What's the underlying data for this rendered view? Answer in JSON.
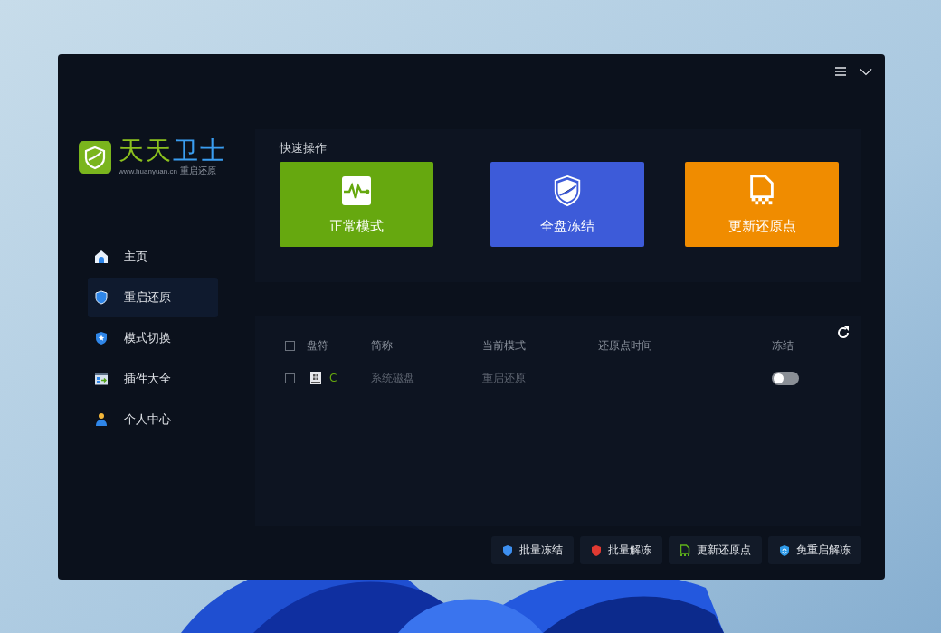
{
  "logo": {
    "title_a": "天天",
    "title_b": "卫士",
    "url": "www.huanyuan.cn",
    "tag": "重启还原"
  },
  "sidebar": {
    "items": [
      {
        "label": "主页",
        "kind": "home",
        "selected": false
      },
      {
        "label": "重启还原",
        "kind": "shield",
        "selected": true
      },
      {
        "label": "模式切换",
        "kind": "star",
        "selected": false
      },
      {
        "label": "插件大全",
        "kind": "plugin",
        "selected": false
      },
      {
        "label": "个人中心",
        "kind": "person",
        "selected": false
      }
    ]
  },
  "quick_actions": {
    "title": "快速操作",
    "cards": [
      {
        "label": "正常模式",
        "kind": "pulse",
        "color": "#66a80f"
      },
      {
        "label": "全盘冻结",
        "kind": "shield",
        "color": "#3d5bd9"
      },
      {
        "label": "更新还原点",
        "kind": "file",
        "color": "#f08c00"
      }
    ]
  },
  "table": {
    "header_checked": false,
    "columns": [
      "盘符",
      "简称",
      "当前模式",
      "还原点时间",
      "冻结"
    ],
    "rows": [
      {
        "checked": false,
        "drive": "C",
        "name": "系统磁盘",
        "mode": "重启还原",
        "frozen": false
      }
    ]
  },
  "buttons": [
    {
      "label": "批量冻结",
      "kind": "freeze"
    },
    {
      "label": "批量解冻",
      "kind": "unfreeze"
    },
    {
      "label": "更新还原点",
      "kind": "file"
    },
    {
      "label": "免重启解冻",
      "kind": "cycle"
    }
  ]
}
